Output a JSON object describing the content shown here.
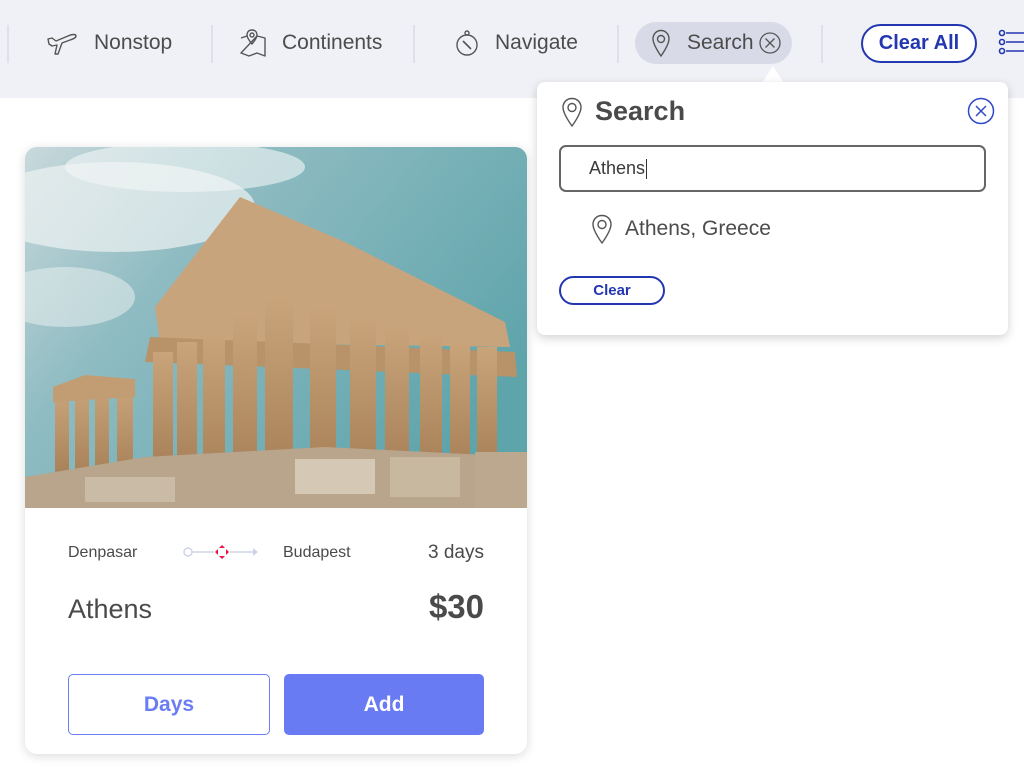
{
  "topbar": {
    "nav": [
      {
        "label": "Nonstop",
        "icon": "airplane-icon"
      },
      {
        "label": "Continents",
        "icon": "map-icon"
      },
      {
        "label": "Navigate",
        "icon": "compass-icon"
      },
      {
        "label": "Search",
        "icon": "location-pin-icon",
        "active": true
      }
    ],
    "clear_all_label": "Clear All",
    "list_icon": "list-icon"
  },
  "search_popover": {
    "title": "Search",
    "input_value": "Athens",
    "results": [
      {
        "label": "Athens, Greece"
      }
    ],
    "clear_label": "Clear"
  },
  "card": {
    "image_alt": "Parthenon, Athens",
    "origin": "Denpasar",
    "destination": "Budapest",
    "duration": "3 days",
    "city": "Athens",
    "price": "$30",
    "days_button": "Days",
    "add_button": "Add",
    "colors": {
      "accent": "#687bf3",
      "route_marker": "#e8174a"
    }
  }
}
